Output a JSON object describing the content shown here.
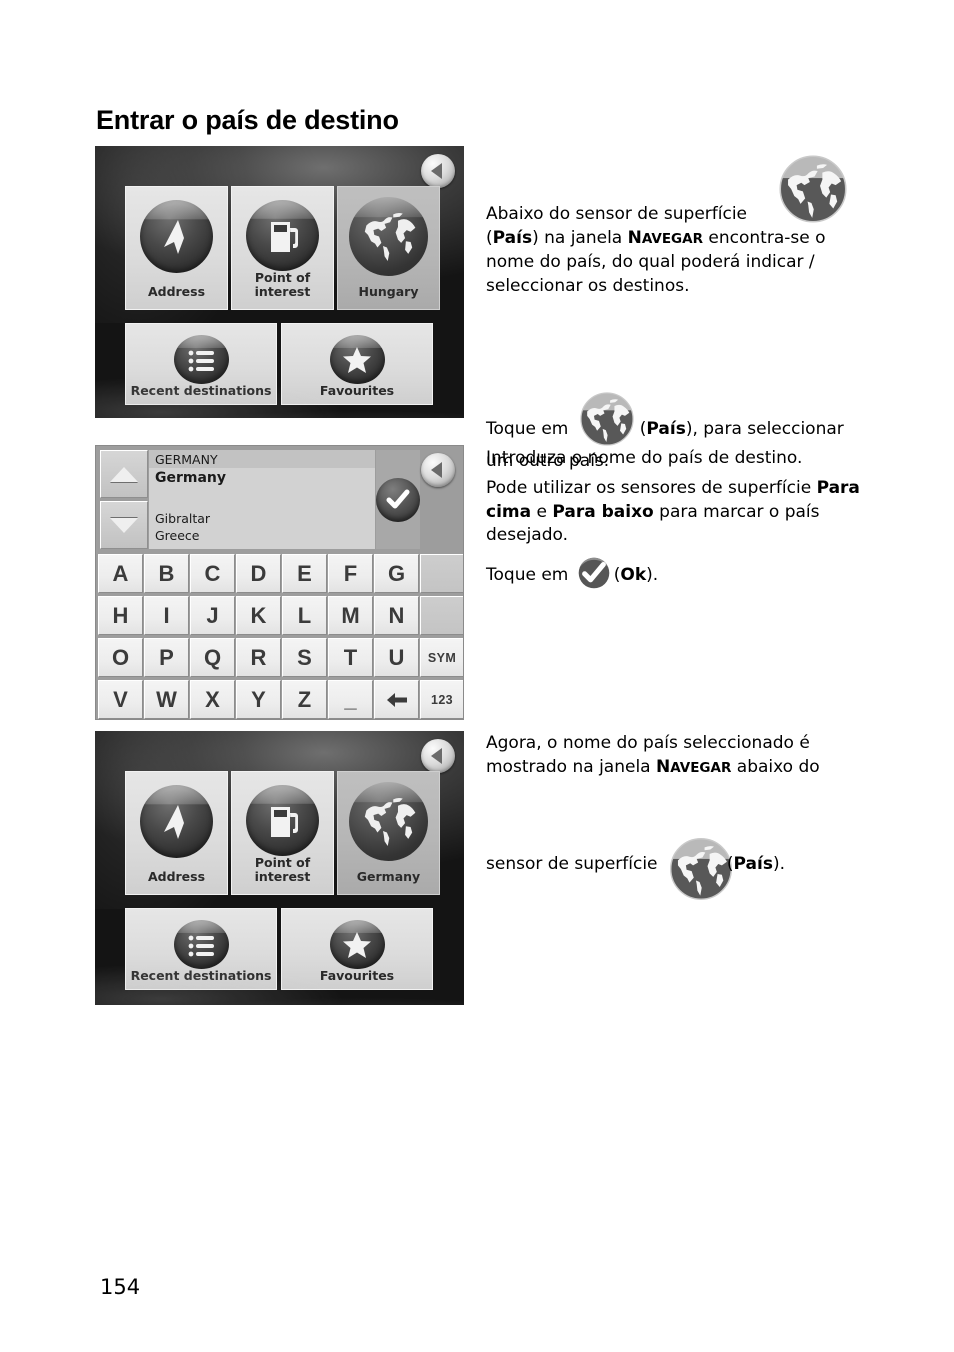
{
  "document": {
    "title": "Entrar o país de destino",
    "page_number": "154"
  },
  "screens": {
    "navigate_hungary": {
      "name": "NAVEGAR",
      "back_button": "back-arrow",
      "tiles": [
        {
          "label": "Address",
          "icon": "flag-marker-icon"
        },
        {
          "label": "Point of\ninterest",
          "icon": "fuel-pump-icon"
        },
        {
          "label": "Hungary",
          "icon": "globe-icon",
          "state": "dim"
        },
        {
          "label": "Recent destinations",
          "icon": "list-icon"
        },
        {
          "label": "Favourites",
          "icon": "star-icon"
        }
      ],
      "tile_labels": {
        "address": "Address",
        "poi_line1": "Point of",
        "poi_line2": "interest",
        "country": "Hungary",
        "recent": "Recent destinations",
        "favourites": "Favourites"
      }
    },
    "country_keyboard": {
      "header": "GERMANY",
      "list": [
        {
          "label": "Germany",
          "selected": true
        },
        {
          "label": "Gibraltar",
          "selected": false
        },
        {
          "label": "Greece",
          "selected": false
        }
      ],
      "scroll_up": "up-arrow",
      "scroll_down": "down-arrow",
      "ok_button": "checkmark",
      "back_button": "back-arrow",
      "keyboard_rows": [
        [
          "A",
          "B",
          "C",
          "D",
          "E",
          "F",
          "G",
          ""
        ],
        [
          "H",
          "I",
          "J",
          "K",
          "L",
          "M",
          "N",
          ""
        ],
        [
          "O",
          "P",
          "Q",
          "R",
          "S",
          "T",
          "U",
          "SYM"
        ],
        [
          "V",
          "W",
          "X",
          "Y",
          "Z",
          "_",
          "←",
          "123"
        ]
      ]
    },
    "navigate_germany": {
      "name": "NAVEGAR",
      "back_button": "back-arrow",
      "tile_labels": {
        "address": "Address",
        "poi_line1": "Point of",
        "poi_line2": "interest",
        "country": "Germany",
        "recent": "Recent destinations",
        "favourites": "Favourites"
      }
    }
  },
  "body": {
    "p1": {
      "part1": "Abaixo do sensor de superfície ",
      "icon": "globe-icon",
      "part2_a": "(",
      "part2_b": "País",
      "part2_c": ") na janela ",
      "smallcaps_n": "N",
      "smallcaps_rest": "AVEGAR",
      "part3": " encontra-se o nome do país, do qual poderá indicar / seleccionar os destinos."
    },
    "p2": {
      "part1": "Toque em ",
      "icon": "globe-icon",
      "part2_a": "(",
      "part2_b": "País",
      "part2_c": "), para seleccionar um outro país."
    },
    "p3": {
      "text": "Introduza o nome do país de destino."
    },
    "p4": {
      "part1": "Pode utilizar os sensores de superfície ",
      "bold1": "Para cima",
      "mid": " e ",
      "bold2": "Para baixo",
      "part2": " para marcar o país desejado."
    },
    "p5": {
      "part1": "Toque em ",
      "icon": "checkmark-icon",
      "part2_a": "(",
      "part2_b": "Ok",
      "part2_c": ")."
    },
    "p6": {
      "part1": "Agora, o nome do país seleccionado é mostrado na janela ",
      "smallcaps_n": "N",
      "smallcaps_rest": "AVEGAR",
      "part2": " abaixo do",
      "part3": "sensor de superfície ",
      "icon": "globe-icon",
      "part4_a": "(",
      "part4_b": "País",
      "part4_c": ")."
    }
  },
  "colors": {
    "page_bg": "#ffffff",
    "text": "#000000",
    "device_dark": "#1a1a1a",
    "tile_light": "#e0e0e0",
    "tile_dim": "#b6b6b6",
    "keyboard_bg": "#9d9d9d",
    "key_face": "#ededed"
  }
}
